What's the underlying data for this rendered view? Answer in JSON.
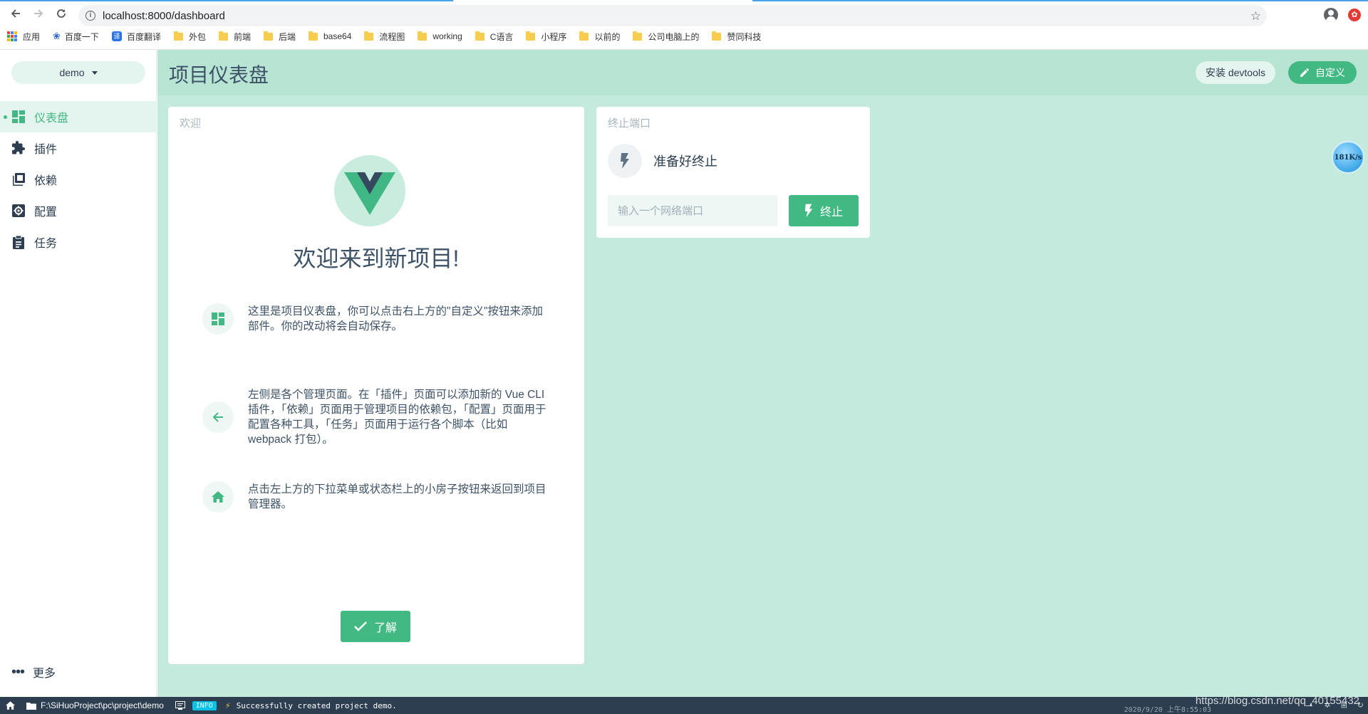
{
  "browser": {
    "url": "localhost:8000/dashboard",
    "bookmarks": [
      "应用",
      "百度一下",
      "百度翻译",
      "外包",
      "前端",
      "后端",
      "base64",
      "流程图",
      "working",
      "C语言",
      "小程序",
      "以前的",
      "公司电脑上的",
      "赞同科技"
    ]
  },
  "sidebar": {
    "project": "demo",
    "items": [
      {
        "label": "仪表盘",
        "icon": "dashboard-icon",
        "active": true
      },
      {
        "label": "插件",
        "icon": "puzzle-icon",
        "active": false
      },
      {
        "label": "依赖",
        "icon": "library-icon",
        "active": false
      },
      {
        "label": "配置",
        "icon": "settings-icon",
        "active": false
      },
      {
        "label": "任务",
        "icon": "assignment-icon",
        "active": false
      }
    ],
    "more": "更多"
  },
  "header": {
    "title": "项目仪表盘",
    "devtools_label": "安装 devtools",
    "customize_label": "自定义"
  },
  "welcome": {
    "card_title": "欢迎",
    "heading": "欢迎来到新项目!",
    "tips": [
      "这里是项目仪表盘，你可以点击右上方的\"自定义\"按钮来添加部件。你的改动将会自动保存。",
      "左侧是各个管理页面。在「插件」页面可以添加新的 Vue CLI 插件，「依赖」页面用于管理项目的依赖包，「配置」页面用于配置各种工具，「任务」页面用于运行各个脚本（比如 webpack 打包）。",
      "点击左上方的下拉菜单或状态栏上的小房子按钮来返回到项目管理器。"
    ],
    "ok_label": "了解"
  },
  "kill_port": {
    "card_title": "终止端口",
    "status": "准备好终止",
    "placeholder": "输入一个网络端口",
    "button": "终止"
  },
  "speed_ball": "181K/s",
  "statusbar": {
    "path": "F:\\SiHuoProject\\pc\\project\\demo",
    "log_level": "INFO",
    "log_message": "Successfully created project demo.",
    "watermark": "https://blog.csdn.net/qq_40155432",
    "date": "2020/9/20 上午8:55:03"
  },
  "colors": {
    "accent": "#42b983",
    "main_bg": "#c4e9dd",
    "header_bg": "#b8e4d3",
    "statusbar_bg": "#2c3e50"
  }
}
